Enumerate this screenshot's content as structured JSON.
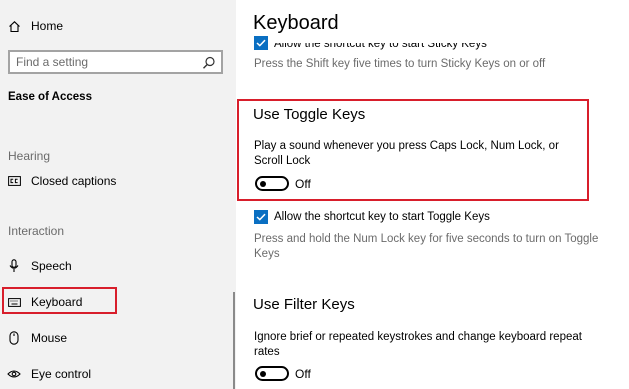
{
  "sidebar": {
    "home_label": "Home",
    "search": {
      "placeholder": "Find a setting"
    },
    "category_title": "Ease of Access",
    "sections": [
      {
        "title": "Hearing"
      },
      {
        "title": "Interaction"
      }
    ],
    "items": [
      {
        "label": "Closed captions",
        "icon": "closed-captions-icon"
      },
      {
        "label": "Speech",
        "icon": "microphone-icon"
      },
      {
        "label": "Keyboard",
        "icon": "keyboard-icon",
        "selected": true
      },
      {
        "label": "Mouse",
        "icon": "mouse-icon"
      },
      {
        "label": "Eye control",
        "icon": "eye-icon"
      }
    ]
  },
  "main": {
    "title": "Keyboard",
    "sticky_keys": {
      "shortcut_label": "Allow the shortcut key to start Sticky Keys",
      "shortcut_checked": true,
      "description": "Press the Shift key five times to turn Sticky Keys on or off"
    },
    "toggle_keys": {
      "heading": "Use Toggle Keys",
      "description": "Play a sound whenever you press Caps Lock, Num Lock, or Scroll Lock",
      "toggle_state": "Off",
      "shortcut_label": "Allow the shortcut key to start Toggle Keys",
      "shortcut_checked": true,
      "shortcut_description": "Press and hold the Num Lock key for five seconds to turn on Toggle Keys"
    },
    "filter_keys": {
      "heading": "Use Filter Keys",
      "description": "Ignore brief or repeated keystrokes and change keyboard repeat rates",
      "toggle_state": "Off"
    }
  },
  "colors": {
    "accent": "#0a6fc2",
    "highlight_box": "#d81e2b",
    "sidebar_bg": "#f2f2f2"
  }
}
